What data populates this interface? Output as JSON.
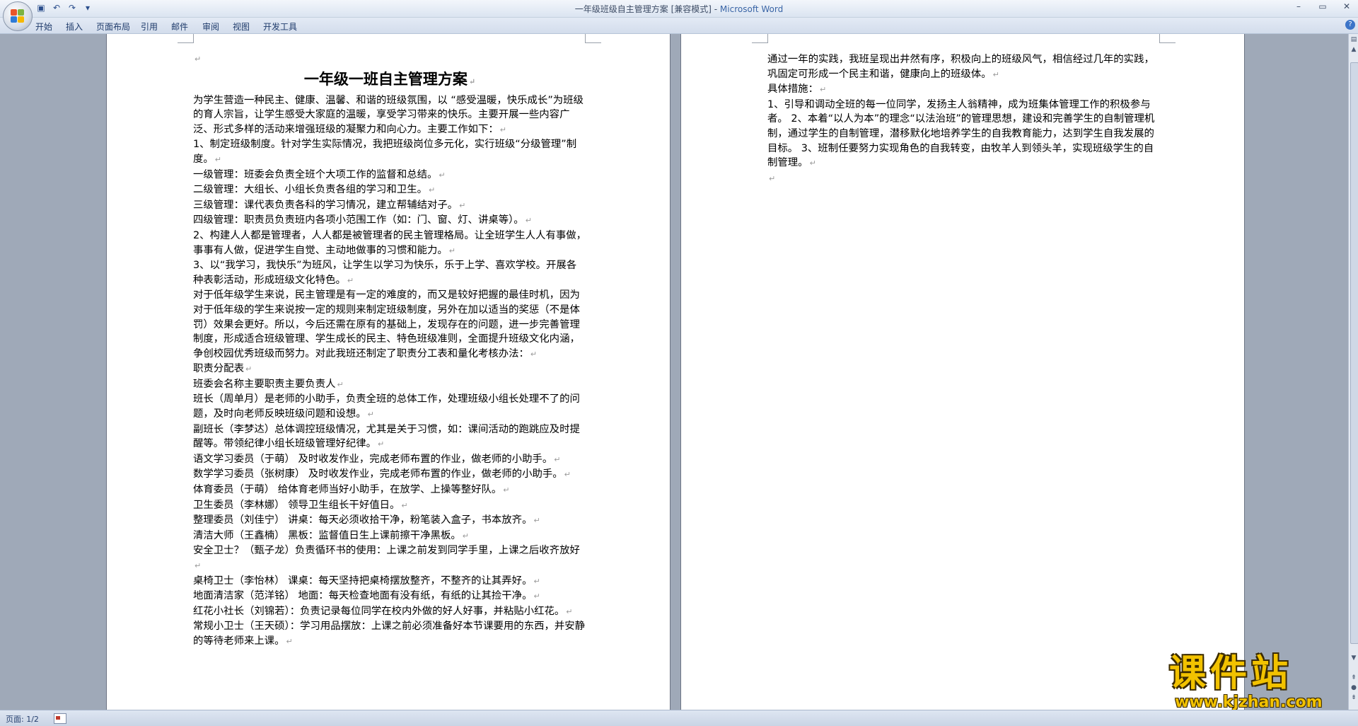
{
  "window": {
    "title": "一年级班级自主管理方案 [兼容模式] - ",
    "app_name": "Microsoft Word",
    "controls": [
      "–",
      "▭",
      "✕"
    ]
  },
  "ribbon": {
    "tabs": [
      "开始",
      "插入",
      "页面布局",
      "引用",
      "邮件",
      "审阅",
      "视图",
      "开发工具"
    ]
  },
  "page1": {
    "title": "一年级一班自主管理方案",
    "paragraphs": [
      "为学生营造一种民主、健康、温馨、和谐的班级氛围，以 “感受温暖，快乐成长”为班级的育人宗旨，让学生感受大家庭的温暖，享受学习带来的快乐。主要开展一些内容广泛、形式多样的活动来增强班级的凝聚力和向心力。主要工作如下：",
      "1、制定班级制度。针对学生实际情况，我把班级岗位多元化，实行班级“分级管理”制度。",
      "一级管理：班委会负责全班个大项工作的监督和总结。",
      "二级管理：大组长、小组长负责各组的学习和卫生。",
      "三级管理：课代表负责各科的学习情况，建立帮辅结对子。",
      "四级管理：职责员负责班内各项小范围工作（如：门、窗、灯、讲桌等）。",
      "2、构建人人都是管理者，人人都是被管理者的民主管理格局。让全班学生人人有事做，事事有人做，促进学生自觉、主动地做事的习惯和能力。",
      "3、以“我学习，我快乐”为班风，让学生以学习为快乐，乐于上学、喜欢学校。开展各种表彰活动，形成班级文化特色。",
      "对于低年级学生来说，民主管理是有一定的难度的，而又是较好把握的最佳时机，因为对于低年级的学生来说按一定的规则来制定班级制度，另外在加以适当的奖惩（不是体罚）效果会更好。所以，今后还需在原有的基础上，发现存在的问题，进一步完善管理制度，形成适合班级管理、学生成长的民主、特色班级准则，全面提升班级文化内涵，争创校园优秀班级而努力。对此我班还制定了职责分工表和量化考核办法：",
      "职责分配表",
      "班委会名称主要职责主要负责人",
      "班长（周单月）是老师的小助手，负责全班的总体工作，处理班级小组长处理不了的问题，及时向老师反映班级问题和设想。",
      "副班长（李梦达）总体调控班级情况，尤其是关于习惯，如：课间活动的跑跳应及时提醒等。带领纪律小组长班级管理好纪律。",
      "语文学习委员（于萌） 及时收发作业，完成老师布置的作业，做老师的小助手。",
      "数学学习委员（张树康） 及时收发作业，完成老师布置的作业，做老师的小助手。",
      "体育委员（于萌） 给体育老师当好小助手，在放学、上操等整好队。",
      "卫生委员（李林娜） 领导卫生组长干好值日。",
      "整理委员（刘佳宁） 讲桌：每天必须收拾干净，粉笔装入盒子，书本放齐。",
      "清洁大师（王鑫楠） 黑板：监督值日生上课前擦干净黑板。",
      "安全卫士？（甄子龙）负责循环书的使用：上课之前发到同学手里，上课之后收齐放好",
      "桌椅卫士（李怡林） 课桌：每天坚持把桌椅摆放整齐，不整齐的让其弄好。",
      "地面清洁家（范洋铭） 地面：每天检查地面有没有纸，有纸的让其捡干净。",
      "红花小社长（刘锦若）：负责记录每位同学在校内外做的好人好事，并粘贴小红花。",
      "常规小卫士（王天硕）：学习用品摆放：上课之前必须准备好本节课要用的东西，并安静的等待老师来上课。"
    ]
  },
  "page2": {
    "paragraphs": [
      "通过一年的实践，我班呈现出井然有序，积极向上的班级风气，相信经过几年的实践，巩固定可形成一个民主和谐，健康向上的班级体。",
      "具体措施：",
      "1、引导和调动全班的每一位同学，发扬主人翁精神，成为班集体管理工作的积极参与者。 2、本着“以人为本”的理念“以法治班”的管理思想，建设和完善学生的自制管理机制，通过学生的自制管理，潜移默化地培养学生的自我教育能力，达到学生自我发展的目标。 3、班制任要努力实现角色的自我转变，由牧羊人到领头羊，实现班级学生的自制管理。",
      ""
    ]
  },
  "status_bar": {
    "page_indicator": "页面: 1/2"
  },
  "watermark": {
    "text": "课件站",
    "url": "www.kjzhan.com"
  },
  "icons": {
    "office_button": "office-logo-icon",
    "qat": [
      "save-icon",
      "undo-icon",
      "redo-icon",
      "customize-qat-icon"
    ],
    "pilcrow": "↵"
  },
  "colors": {
    "title_app": "#3a65a6",
    "watermark": "#f2c200",
    "doc_background": "#9fa9b8"
  }
}
